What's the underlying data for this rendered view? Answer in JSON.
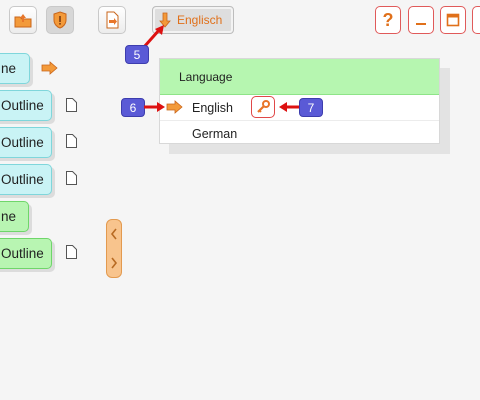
{
  "toolbar": {
    "language_button_label": "Englisch",
    "open_icon": "folder-up-icon",
    "shield_icon": "shield-icon",
    "export_icon": "document-export-icon",
    "help_icon": "help-icon",
    "minimize_icon": "minimize-icon",
    "maximize_icon": "maximize-icon",
    "close_icon": "close-icon"
  },
  "outline_nodes": [
    {
      "label": "ne",
      "color": "cyan"
    },
    {
      "label": "Outline",
      "color": "cyan"
    },
    {
      "label": "Outline",
      "color": "cyan"
    },
    {
      "label": "Outline",
      "color": "cyan"
    },
    {
      "label": "ne",
      "color": "green"
    },
    {
      "label": "Outline",
      "color": "green"
    }
  ],
  "language_panel": {
    "header": "Language",
    "options": [
      "English",
      "German"
    ]
  },
  "callouts": [
    "5",
    "6",
    "7"
  ],
  "colors": {
    "accent_orange": "#e8762a",
    "callout_blue": "#5a5ad6",
    "header_green": "#b6f6b0",
    "node_cyan": "#c9f3f5",
    "node_green": "#b8f5b2",
    "pointer_red": "#dd1111"
  }
}
